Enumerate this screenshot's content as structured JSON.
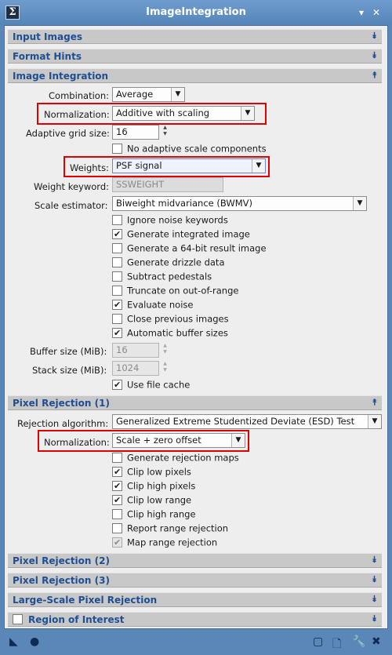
{
  "window": {
    "title": "ImageIntegration"
  },
  "sections": {
    "input_images": "Input Images",
    "format_hints": "Format Hints",
    "image_integration": "Image Integration",
    "pixel_rejection_1": "Pixel Rejection (1)",
    "pixel_rejection_2": "Pixel Rejection (2)",
    "pixel_rejection_3": "Pixel Rejection (3)",
    "large_scale": "Large-Scale Pixel Rejection",
    "roi": "Region of Interest"
  },
  "integration": {
    "combination_label": "Combination:",
    "combination_value": "Average",
    "normalization_label": "Normalization:",
    "normalization_value": "Additive with scaling",
    "grid_label": "Adaptive grid size:",
    "grid_value": "16",
    "no_adaptive": "No adaptive scale components",
    "weights_label": "Weights:",
    "weights_value": "PSF signal",
    "weight_keyword_label": "Weight keyword:",
    "weight_keyword_value": "SSWEIGHT",
    "scale_label": "Scale estimator:",
    "scale_value": "Biweight midvariance (BWMV)",
    "checks": [
      {
        "label": "Ignore noise keywords",
        "checked": false
      },
      {
        "label": "Generate integrated image",
        "checked": true
      },
      {
        "label": "Generate a 64-bit result image",
        "checked": false
      },
      {
        "label": "Generate drizzle data",
        "checked": false
      },
      {
        "label": "Subtract pedestals",
        "checked": false
      },
      {
        "label": "Truncate on out-of-range",
        "checked": false
      },
      {
        "label": "Evaluate noise",
        "checked": true
      },
      {
        "label": "Close previous images",
        "checked": false
      },
      {
        "label": "Automatic buffer sizes",
        "checked": true
      }
    ],
    "buffer_label": "Buffer size (MiB):",
    "buffer_value": "16",
    "stack_label": "Stack size (MiB):",
    "stack_value": "1024",
    "file_cache": "Use file cache"
  },
  "rejection": {
    "algorithm_label": "Rejection algorithm:",
    "algorithm_value": "Generalized Extreme Studentized Deviate (ESD) Test",
    "normalization_label": "Normalization:",
    "normalization_value": "Scale + zero offset",
    "checks": [
      {
        "label": "Generate rejection maps",
        "checked": false
      },
      {
        "label": "Clip low pixels",
        "checked": true
      },
      {
        "label": "Clip high pixels",
        "checked": true
      },
      {
        "label": "Clip low range",
        "checked": true
      },
      {
        "label": "Clip high range",
        "checked": false
      },
      {
        "label": "Report range rejection",
        "checked": false
      },
      {
        "label": "Map range rejection",
        "checked": true,
        "disabled": true
      }
    ]
  },
  "icons": {
    "app": "sigma-icon",
    "pin": "pin-icon",
    "close": "close-icon",
    "new_instance": "triangle-icon",
    "apply_global": "circle-icon",
    "preview": "square-icon",
    "document": "document-icon",
    "edit": "wrench-icon",
    "reset": "reset-icon"
  }
}
